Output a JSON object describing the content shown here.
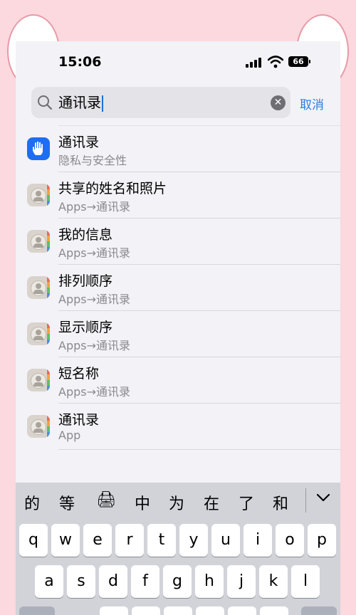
{
  "status_bar": {
    "time": "15:06",
    "battery": "66"
  },
  "search": {
    "query": "通讯录",
    "cancel_label": "取消"
  },
  "results": [
    {
      "title": "通讯录",
      "subtitle": "隐私与安全性",
      "icon": "privacy-hand-icon"
    },
    {
      "title": "共享的姓名和照片",
      "subtitle": "Apps→通讯录",
      "icon": "contacts-app-icon"
    },
    {
      "title": "我的信息",
      "subtitle": "Apps→通讯录",
      "icon": "contacts-app-icon"
    },
    {
      "title": "排列顺序",
      "subtitle": "Apps→通讯录",
      "icon": "contacts-app-icon"
    },
    {
      "title": "显示顺序",
      "subtitle": "Apps→通讯录",
      "icon": "contacts-app-icon"
    },
    {
      "title": "短名称",
      "subtitle": "Apps→通讯录",
      "icon": "contacts-app-icon"
    },
    {
      "title": "通讯录",
      "subtitle": "App",
      "icon": "contacts-app-icon"
    }
  ],
  "keyboard": {
    "candidates": [
      "的",
      "等",
      "🖨",
      "中",
      "为",
      "在",
      "了",
      "和"
    ],
    "row1": [
      "q",
      "w",
      "e",
      "r",
      "t",
      "y",
      "u",
      "i",
      "o",
      "p"
    ],
    "row2": [
      "a",
      "s",
      "d",
      "f",
      "g",
      "h",
      "j",
      "k",
      "l"
    ]
  },
  "colors": {
    "accent": "#2a7de1",
    "privacy_icon": "#1d6ef2",
    "background": "#fbd9de"
  }
}
